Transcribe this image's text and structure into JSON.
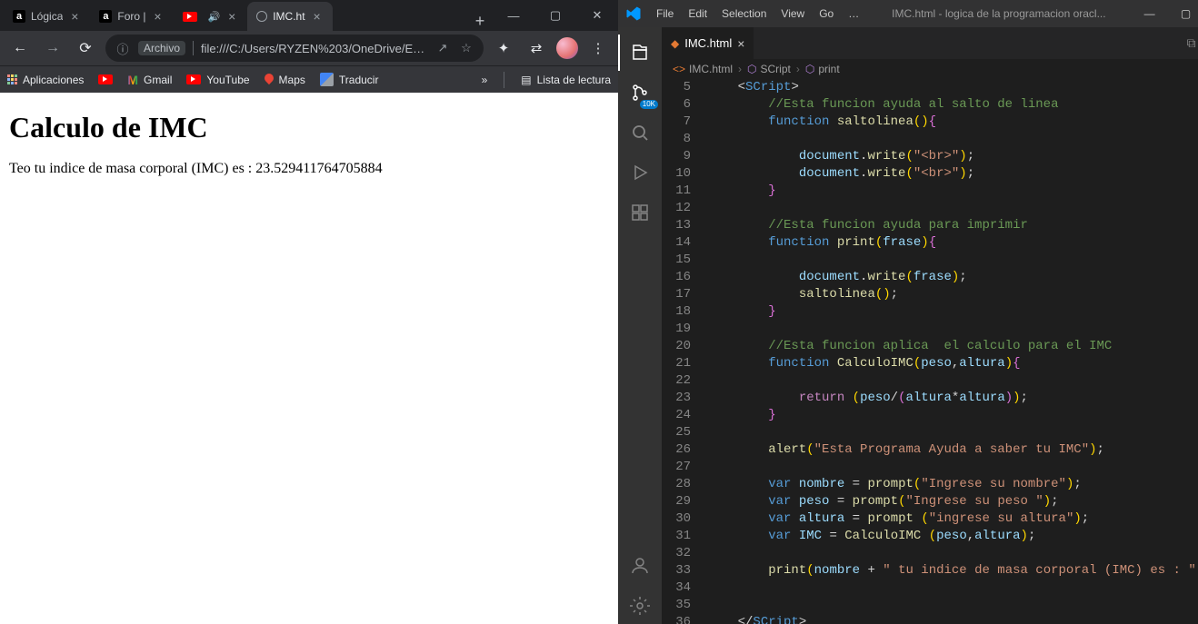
{
  "chrome": {
    "tabs": [
      {
        "label": "Lógica",
        "favicon_text": "a",
        "favicon_bg": "#202124",
        "active": false
      },
      {
        "label": "Foro | ",
        "favicon_text": "a",
        "favicon_bg": "#202124",
        "active": false
      },
      {
        "label": "",
        "favicon_type": "youtube",
        "audio": true,
        "active": false
      },
      {
        "label": "IMC.ht",
        "favicon_type": "globe",
        "active": true
      }
    ],
    "win_controls": {
      "min": "—",
      "max": "▢",
      "close": "✕"
    },
    "nav": {
      "back": "←",
      "forward": "→",
      "reload": "⟳"
    },
    "omnibox": {
      "info_icon": "ⓘ",
      "scheme_label": "Archivo",
      "url": "file:///C:/Users/RYZEN%203/OneDrive/Es...",
      "share": "↗",
      "star": "☆"
    },
    "toolbar": {
      "extensions": "✦",
      "settings": "⇄"
    },
    "bookmarks": {
      "apps": "Aplicaciones",
      "items": [
        {
          "type": "youtube",
          "label": ""
        },
        {
          "type": "gmail",
          "label": "Gmail"
        },
        {
          "type": "youtube",
          "label": "YouTube"
        },
        {
          "type": "maps",
          "label": "Maps"
        },
        {
          "type": "translate",
          "label": "Traducir"
        }
      ],
      "overflow": "»",
      "reading_list": "Lista de lectura",
      "reading_icon": "▤"
    },
    "page": {
      "h1": "Calculo de IMC",
      "text": "Teo tu indice de masa corporal (IMC) es : 23.529411764705884"
    }
  },
  "vscode": {
    "title": "IMC.html - logica de la programacion oracl...",
    "menu": [
      "File",
      "Edit",
      "Selection",
      "View",
      "Go",
      "…"
    ],
    "win": {
      "min": "—",
      "max": "▢",
      "close": "✕"
    },
    "activity": {
      "explorer": "files-icon",
      "source_badge": "10K",
      "search": "search-icon",
      "run": "run-icon",
      "extensions": "ext-icon",
      "account": "account-icon",
      "settings": "gear-icon"
    },
    "tab": {
      "filename": "IMC.html"
    },
    "breadcrumbs": [
      {
        "icon": "file",
        "label": "IMC.html"
      },
      {
        "icon": "sym",
        "label": "SCript"
      },
      {
        "icon": "sym",
        "label": "print"
      }
    ],
    "code_lines": [
      {
        "n": 5,
        "seg": [
          {
            "c": "tok-punc",
            "t": "    <"
          },
          {
            "c": "tok-tag",
            "t": "SCript"
          },
          {
            "c": "tok-punc",
            "t": ">"
          }
        ]
      },
      {
        "n": 6,
        "seg": [
          {
            "c": "",
            "t": "        "
          },
          {
            "c": "tok-cm",
            "t": "//Esta funcion ayuda al salto de linea"
          }
        ]
      },
      {
        "n": 7,
        "seg": [
          {
            "c": "",
            "t": "        "
          },
          {
            "c": "tok-kw",
            "t": "function"
          },
          {
            "c": "",
            "t": " "
          },
          {
            "c": "tok-fn",
            "t": "saltolinea"
          },
          {
            "c": "tok-brace",
            "t": "()"
          },
          {
            "c": "tok-brace2",
            "t": "{"
          }
        ]
      },
      {
        "n": 8,
        "seg": [
          {
            "c": "",
            "t": ""
          }
        ]
      },
      {
        "n": 9,
        "seg": [
          {
            "c": "",
            "t": "            "
          },
          {
            "c": "tok-obj",
            "t": "document"
          },
          {
            "c": "",
            "t": "."
          },
          {
            "c": "tok-fn",
            "t": "write"
          },
          {
            "c": "tok-brace",
            "t": "("
          },
          {
            "c": "tok-str",
            "t": "\"<br>\""
          },
          {
            "c": "tok-brace",
            "t": ")"
          },
          {
            "c": "",
            "t": ";"
          }
        ]
      },
      {
        "n": 10,
        "seg": [
          {
            "c": "",
            "t": "            "
          },
          {
            "c": "tok-obj",
            "t": "document"
          },
          {
            "c": "",
            "t": "."
          },
          {
            "c": "tok-fn",
            "t": "write"
          },
          {
            "c": "tok-brace",
            "t": "("
          },
          {
            "c": "tok-str",
            "t": "\"<br>\""
          },
          {
            "c": "tok-brace",
            "t": ")"
          },
          {
            "c": "",
            "t": ";"
          }
        ]
      },
      {
        "n": 11,
        "seg": [
          {
            "c": "",
            "t": "        "
          },
          {
            "c": "tok-brace2",
            "t": "}"
          }
        ]
      },
      {
        "n": 12,
        "seg": [
          {
            "c": "",
            "t": ""
          }
        ]
      },
      {
        "n": 13,
        "seg": [
          {
            "c": "",
            "t": "        "
          },
          {
            "c": "tok-cm",
            "t": "//Esta funcion ayuda para imprimir"
          }
        ]
      },
      {
        "n": 14,
        "seg": [
          {
            "c": "",
            "t": "        "
          },
          {
            "c": "tok-kw",
            "t": "function"
          },
          {
            "c": "",
            "t": " "
          },
          {
            "c": "tok-fn",
            "t": "print"
          },
          {
            "c": "tok-brace",
            "t": "("
          },
          {
            "c": "tok-var",
            "t": "frase"
          },
          {
            "c": "tok-brace",
            "t": ")"
          },
          {
            "c": "tok-brace2",
            "t": "{"
          }
        ]
      },
      {
        "n": 15,
        "seg": [
          {
            "c": "",
            "t": ""
          }
        ]
      },
      {
        "n": 16,
        "seg": [
          {
            "c": "",
            "t": "            "
          },
          {
            "c": "tok-obj",
            "t": "document"
          },
          {
            "c": "",
            "t": "."
          },
          {
            "c": "tok-fn",
            "t": "write"
          },
          {
            "c": "tok-brace",
            "t": "("
          },
          {
            "c": "tok-var",
            "t": "frase"
          },
          {
            "c": "tok-brace",
            "t": ")"
          },
          {
            "c": "",
            "t": ";"
          }
        ]
      },
      {
        "n": 17,
        "seg": [
          {
            "c": "",
            "t": "            "
          },
          {
            "c": "tok-fn",
            "t": "saltolinea"
          },
          {
            "c": "tok-brace",
            "t": "()"
          },
          {
            "c": "",
            "t": ";"
          }
        ]
      },
      {
        "n": 18,
        "seg": [
          {
            "c": "",
            "t": "        "
          },
          {
            "c": "tok-brace2",
            "t": "}"
          }
        ]
      },
      {
        "n": 19,
        "seg": [
          {
            "c": "",
            "t": ""
          }
        ]
      },
      {
        "n": 20,
        "seg": [
          {
            "c": "",
            "t": "        "
          },
          {
            "c": "tok-cm",
            "t": "//Esta funcion aplica  el calculo para el IMC"
          }
        ]
      },
      {
        "n": 21,
        "seg": [
          {
            "c": "",
            "t": "        "
          },
          {
            "c": "tok-kw",
            "t": "function"
          },
          {
            "c": "",
            "t": " "
          },
          {
            "c": "tok-fn",
            "t": "CalculoIMC"
          },
          {
            "c": "tok-brace",
            "t": "("
          },
          {
            "c": "tok-var",
            "t": "peso"
          },
          {
            "c": "",
            "t": ","
          },
          {
            "c": "tok-var",
            "t": "altura"
          },
          {
            "c": "tok-brace",
            "t": ")"
          },
          {
            "c": "tok-brace2",
            "t": "{"
          }
        ]
      },
      {
        "n": 22,
        "seg": [
          {
            "c": "",
            "t": ""
          }
        ]
      },
      {
        "n": 23,
        "seg": [
          {
            "c": "",
            "t": "            "
          },
          {
            "c": "tok-ret",
            "t": "return"
          },
          {
            "c": "",
            "t": " "
          },
          {
            "c": "tok-brace",
            "t": "("
          },
          {
            "c": "tok-var",
            "t": "peso"
          },
          {
            "c": "",
            "t": "/"
          },
          {
            "c": "tok-brace2",
            "t": "("
          },
          {
            "c": "tok-var",
            "t": "altura"
          },
          {
            "c": "",
            "t": "*"
          },
          {
            "c": "tok-var",
            "t": "altura"
          },
          {
            "c": "tok-brace2",
            "t": ")"
          },
          {
            "c": "tok-brace",
            "t": ")"
          },
          {
            "c": "",
            "t": ";"
          }
        ]
      },
      {
        "n": 24,
        "seg": [
          {
            "c": "",
            "t": "        "
          },
          {
            "c": "tok-brace2",
            "t": "}"
          }
        ]
      },
      {
        "n": 25,
        "seg": [
          {
            "c": "",
            "t": ""
          }
        ]
      },
      {
        "n": 26,
        "seg": [
          {
            "c": "",
            "t": "        "
          },
          {
            "c": "tok-fn",
            "t": "alert"
          },
          {
            "c": "tok-brace",
            "t": "("
          },
          {
            "c": "tok-str",
            "t": "\"Esta Programa Ayuda a saber tu IMC\""
          },
          {
            "c": "tok-brace",
            "t": ")"
          },
          {
            "c": "",
            "t": ";"
          }
        ]
      },
      {
        "n": 27,
        "seg": [
          {
            "c": "",
            "t": ""
          }
        ]
      },
      {
        "n": 28,
        "seg": [
          {
            "c": "",
            "t": "        "
          },
          {
            "c": "tok-kw",
            "t": "var"
          },
          {
            "c": "",
            "t": " "
          },
          {
            "c": "tok-var",
            "t": "nombre"
          },
          {
            "c": "",
            "t": " = "
          },
          {
            "c": "tok-fn",
            "t": "prompt"
          },
          {
            "c": "tok-brace",
            "t": "("
          },
          {
            "c": "tok-str",
            "t": "\"Ingrese su nombre\""
          },
          {
            "c": "tok-brace",
            "t": ")"
          },
          {
            "c": "",
            "t": ";"
          }
        ]
      },
      {
        "n": 29,
        "seg": [
          {
            "c": "",
            "t": "        "
          },
          {
            "c": "tok-kw",
            "t": "var"
          },
          {
            "c": "",
            "t": " "
          },
          {
            "c": "tok-var",
            "t": "peso"
          },
          {
            "c": "",
            "t": " = "
          },
          {
            "c": "tok-fn",
            "t": "prompt"
          },
          {
            "c": "tok-brace",
            "t": "("
          },
          {
            "c": "tok-str",
            "t": "\"Ingrese su peso \""
          },
          {
            "c": "tok-brace",
            "t": ")"
          },
          {
            "c": "",
            "t": ";"
          }
        ]
      },
      {
        "n": 30,
        "seg": [
          {
            "c": "",
            "t": "        "
          },
          {
            "c": "tok-kw",
            "t": "var"
          },
          {
            "c": "",
            "t": " "
          },
          {
            "c": "tok-var",
            "t": "altura"
          },
          {
            "c": "",
            "t": " = "
          },
          {
            "c": "tok-fn",
            "t": "prompt"
          },
          {
            "c": "",
            "t": " "
          },
          {
            "c": "tok-brace",
            "t": "("
          },
          {
            "c": "tok-str",
            "t": "\"ingrese su altura\""
          },
          {
            "c": "tok-brace",
            "t": ")"
          },
          {
            "c": "",
            "t": ";"
          }
        ]
      },
      {
        "n": 31,
        "seg": [
          {
            "c": "",
            "t": "        "
          },
          {
            "c": "tok-kw",
            "t": "var"
          },
          {
            "c": "",
            "t": " "
          },
          {
            "c": "tok-var",
            "t": "IMC"
          },
          {
            "c": "",
            "t": " = "
          },
          {
            "c": "tok-fn",
            "t": "CalculoIMC"
          },
          {
            "c": "",
            "t": " "
          },
          {
            "c": "tok-brace",
            "t": "("
          },
          {
            "c": "tok-var",
            "t": "peso"
          },
          {
            "c": "",
            "t": ","
          },
          {
            "c": "tok-var",
            "t": "altura"
          },
          {
            "c": "tok-brace",
            "t": ")"
          },
          {
            "c": "",
            "t": ";"
          }
        ]
      },
      {
        "n": 32,
        "seg": [
          {
            "c": "",
            "t": ""
          }
        ]
      },
      {
        "n": 33,
        "seg": [
          {
            "c": "",
            "t": "        "
          },
          {
            "c": "tok-fn",
            "t": "print"
          },
          {
            "c": "tok-brace",
            "t": "("
          },
          {
            "c": "tok-var",
            "t": "nombre"
          },
          {
            "c": "",
            "t": " + "
          },
          {
            "c": "tok-str",
            "t": "\" tu indice de masa corporal (IMC) es : \""
          },
          {
            "c": "",
            "t": " +"
          }
        ]
      },
      {
        "n": 34,
        "seg": [
          {
            "c": "",
            "t": ""
          }
        ]
      },
      {
        "n": 35,
        "seg": [
          {
            "c": "",
            "t": ""
          }
        ]
      },
      {
        "n": 36,
        "seg": [
          {
            "c": "",
            "t": "    </"
          },
          {
            "c": "tok-tag",
            "t": "SCript"
          },
          {
            "c": "",
            "t": ">"
          }
        ]
      }
    ]
  }
}
